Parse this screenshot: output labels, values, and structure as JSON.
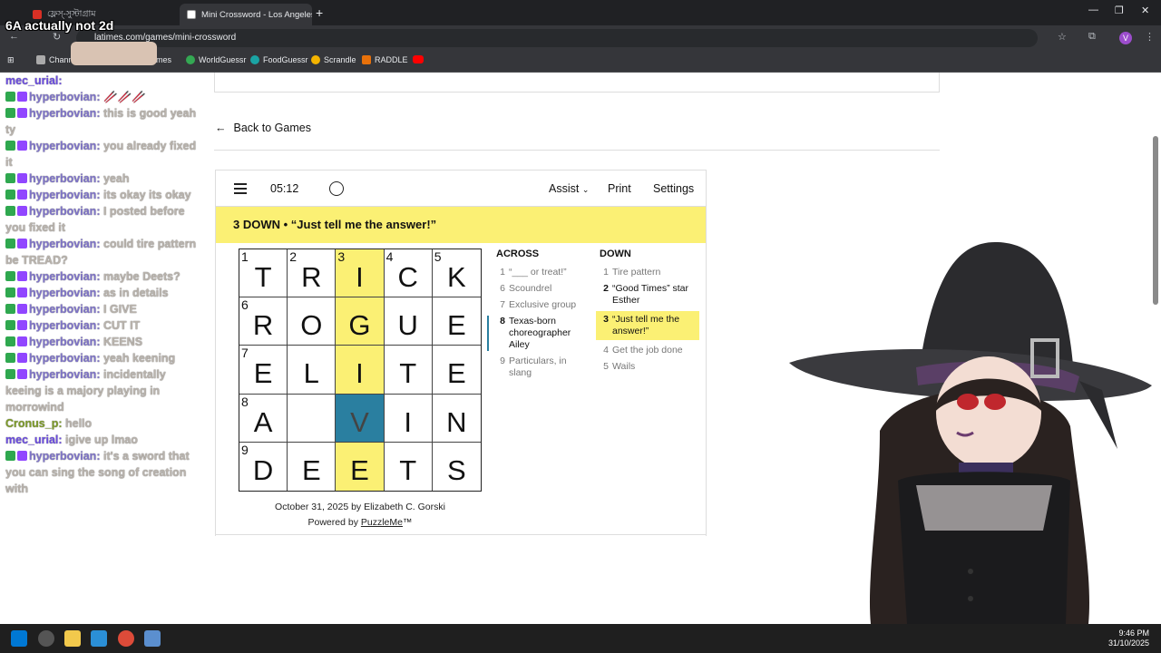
{
  "stream_title": "6A actually not 2d",
  "browser": {
    "tab1_title": "ফ্লেস্-সুস্টাগ্রাম",
    "tab2_title": "Mini Crossword - Los Angeles T",
    "url": "latimes.com/games/mini-crossword",
    "profile_initial": "V",
    "bookmarks": [
      "Channel",
      "Games",
      "WorldGuessr",
      "FoodGuessr",
      "Scrandle",
      "RADDLE"
    ]
  },
  "chat": [
    {
      "user": "mec_urial:",
      "text": "",
      "style": "user2"
    },
    {
      "user": "hyperbovian:",
      "text": "🥢🥢🥢"
    },
    {
      "user": "hyperbovian:",
      "text": "this is good yeah ty"
    },
    {
      "user": "hyperbovian:",
      "text": "you already fixed it"
    },
    {
      "user": "hyperbovian:",
      "text": "yeah"
    },
    {
      "user": "hyperbovian:",
      "text": "its okay its okay"
    },
    {
      "user": "hyperbovian:",
      "text": "I posted before you fixed it"
    },
    {
      "user": "hyperbovian:",
      "text": "could tire pattern be TREAD?"
    },
    {
      "user": "hyperbovian:",
      "text": "maybe Deets?"
    },
    {
      "user": "hyperbovian:",
      "text": "as in details"
    },
    {
      "user": "hyperbovian:",
      "text": "I GIVE"
    },
    {
      "user": "hyperbovian:",
      "text": "CUT IT"
    },
    {
      "user": "hyperbovian:",
      "text": "KEENS"
    },
    {
      "user": "hyperbovian:",
      "text": "yeah keening"
    },
    {
      "user": "hyperbovian:",
      "text": "incidentally keeing is a majory playing in morrowind"
    },
    {
      "user": "Cronus_p:",
      "text": "hello",
      "style": "user3"
    },
    {
      "user": "mec_urial:",
      "text": "igive up lmao",
      "style": "user2"
    },
    {
      "user": "hyperbovian:",
      "text": "it's a sword that you can sing the song of creation with"
    }
  ],
  "page": {
    "back_label": "Back to Games",
    "timer": "05:12",
    "assist": "Assist",
    "print": "Print",
    "settings": "Settings",
    "current_clue": "3 DOWN  •  “Just tell me the answer!”",
    "grid": [
      [
        {
          "n": "1",
          "l": "T"
        },
        {
          "n": "2",
          "l": "R"
        },
        {
          "n": "3",
          "l": "I",
          "c": "hl"
        },
        {
          "n": "4",
          "l": "C"
        },
        {
          "n": "5",
          "l": "K"
        }
      ],
      [
        {
          "n": "6",
          "l": "R"
        },
        {
          "n": "",
          "l": "O"
        },
        {
          "n": "",
          "l": "G",
          "c": "hl"
        },
        {
          "n": "",
          "l": "U"
        },
        {
          "n": "",
          "l": "E"
        }
      ],
      [
        {
          "n": "7",
          "l": "E"
        },
        {
          "n": "",
          "l": "L"
        },
        {
          "n": "",
          "l": "I",
          "c": "hl"
        },
        {
          "n": "",
          "l": "T"
        },
        {
          "n": "",
          "l": "E"
        }
      ],
      [
        {
          "n": "8",
          "l": "A"
        },
        {
          "n": "",
          "l": ""
        },
        {
          "n": "",
          "l": "V",
          "c": "act"
        },
        {
          "n": "",
          "l": "I"
        },
        {
          "n": "",
          "l": "N"
        }
      ],
      [
        {
          "n": "9",
          "l": "D"
        },
        {
          "n": "",
          "l": "E"
        },
        {
          "n": "",
          "l": "E",
          "c": "hl"
        },
        {
          "n": "",
          "l": "T"
        },
        {
          "n": "",
          "l": "S"
        }
      ]
    ],
    "across_heading": "ACROSS",
    "down_heading": "DOWN",
    "across": [
      {
        "n": "1",
        "t": "“___ or treat!”"
      },
      {
        "n": "6",
        "t": "Scoundrel"
      },
      {
        "n": "7",
        "t": "Exclusive group"
      },
      {
        "n": "8",
        "t": "Texas-born choreographer Ailey",
        "s": "bar"
      },
      {
        "n": "9",
        "t": "Particulars, in slang"
      }
    ],
    "down": [
      {
        "n": "1",
        "t": "Tire pattern"
      },
      {
        "n": "2",
        "t": "“Good Times” star Esther",
        "s": "on"
      },
      {
        "n": "3",
        "t": "“Just tell me the answer!”",
        "s": "cur"
      },
      {
        "n": "4",
        "t": "Get the job done"
      },
      {
        "n": "5",
        "t": "Wails"
      }
    ],
    "credit_line": "October 31, 2025 by Elizabeth C. Gorski",
    "powered_prefix": "Powered by ",
    "powered_link": "PuzzleMe",
    "powered_suffix": "™"
  },
  "taskbar": {
    "time": "9:46 PM",
    "date": "31/10/2025"
  }
}
